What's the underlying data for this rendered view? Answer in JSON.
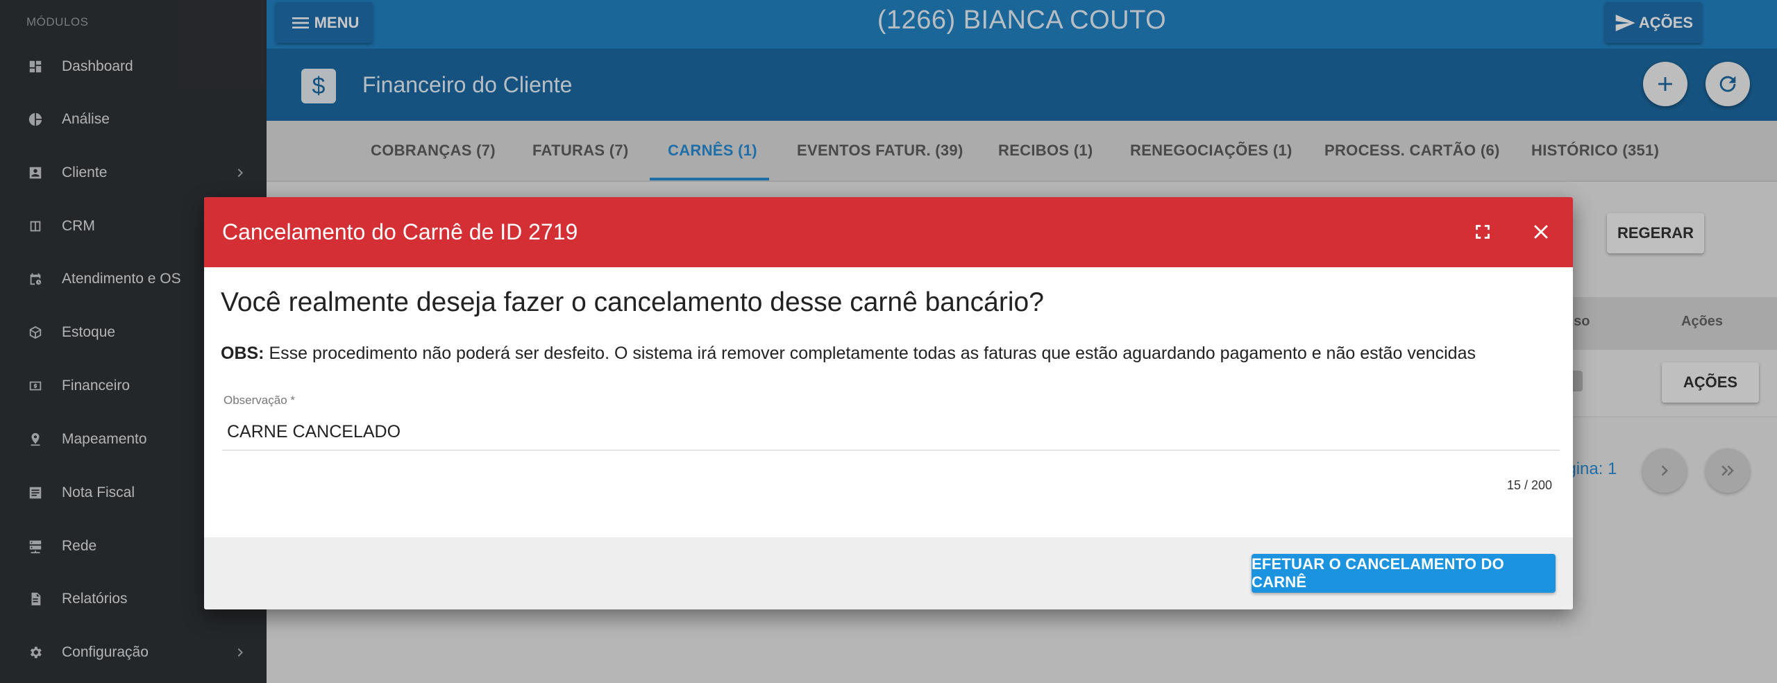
{
  "sidebar": {
    "section_label": "MÓDULOS",
    "items": [
      {
        "label": "Dashboard",
        "icon": "dashboard-icon"
      },
      {
        "label": "Análise",
        "icon": "pie-chart-icon"
      },
      {
        "label": "Cliente",
        "icon": "contact-card-icon"
      },
      {
        "label": "CRM",
        "icon": "book-icon"
      },
      {
        "label": "Atendimento e OS",
        "icon": "calendar-clock-icon"
      },
      {
        "label": "Estoque",
        "icon": "package-icon"
      },
      {
        "label": "Financeiro",
        "icon": "money-icon"
      },
      {
        "label": "Mapeamento",
        "icon": "map-pin-icon"
      },
      {
        "label": "Nota Fiscal",
        "icon": "list-icon"
      },
      {
        "label": "Rede",
        "icon": "server-icon"
      },
      {
        "label": "Relatórios",
        "icon": "document-icon"
      },
      {
        "label": "Configuração",
        "icon": "gear-icon"
      }
    ]
  },
  "topbar": {
    "menu_label": "MENU",
    "client_title": "(1266) BIANCA COUTO",
    "actions_label": "AÇÕES"
  },
  "header": {
    "dollar_symbol": "$",
    "title": "Financeiro do Cliente"
  },
  "tabs": [
    {
      "label": "COBRANÇAS (7)"
    },
    {
      "label": "FATURAS (7)"
    },
    {
      "label": "CARNÊS (1)",
      "active": true
    },
    {
      "label": "EVENTOS FATUR. (39)"
    },
    {
      "label": "RECIBOS (1)"
    },
    {
      "label": "RENEGOCIAÇÕES (1)"
    },
    {
      "label": "PROCESS. CARTÃO (6)"
    },
    {
      "label": "HISTÓRICO (351)"
    }
  ],
  "background": {
    "regerar_label": "REGERAR",
    "col_partial": "sso",
    "col_acoes": "Ações",
    "row_acoes_label": "AÇÕES",
    "pager_partial": "ágina: 1"
  },
  "dialog": {
    "title": "Cancelamento do Carnê de ID 2719",
    "question": "Você realmente deseja fazer o cancelamento desse carnê bancário?",
    "obs_label": "OBS:",
    "obs_text": " Esse procedimento não poderá ser desfeito. O sistema irá remover completamente todas as faturas que estão aguardando pagamento e não estão vencidas",
    "field_label": "Observação *",
    "field_value": "CARNE CANCELADO",
    "counter": "15 / 200",
    "submit_label": "EFETUAR O CANCELAMENTO DO CARNÊ"
  },
  "colors": {
    "sidebar_bg": "#2f3236",
    "topbar_bg": "#2283c4",
    "header_bg": "#1c6aa3",
    "dialog_header_bg": "#d32f35",
    "primary_button": "#1c93df",
    "active_tab": "#2a8ed6"
  }
}
